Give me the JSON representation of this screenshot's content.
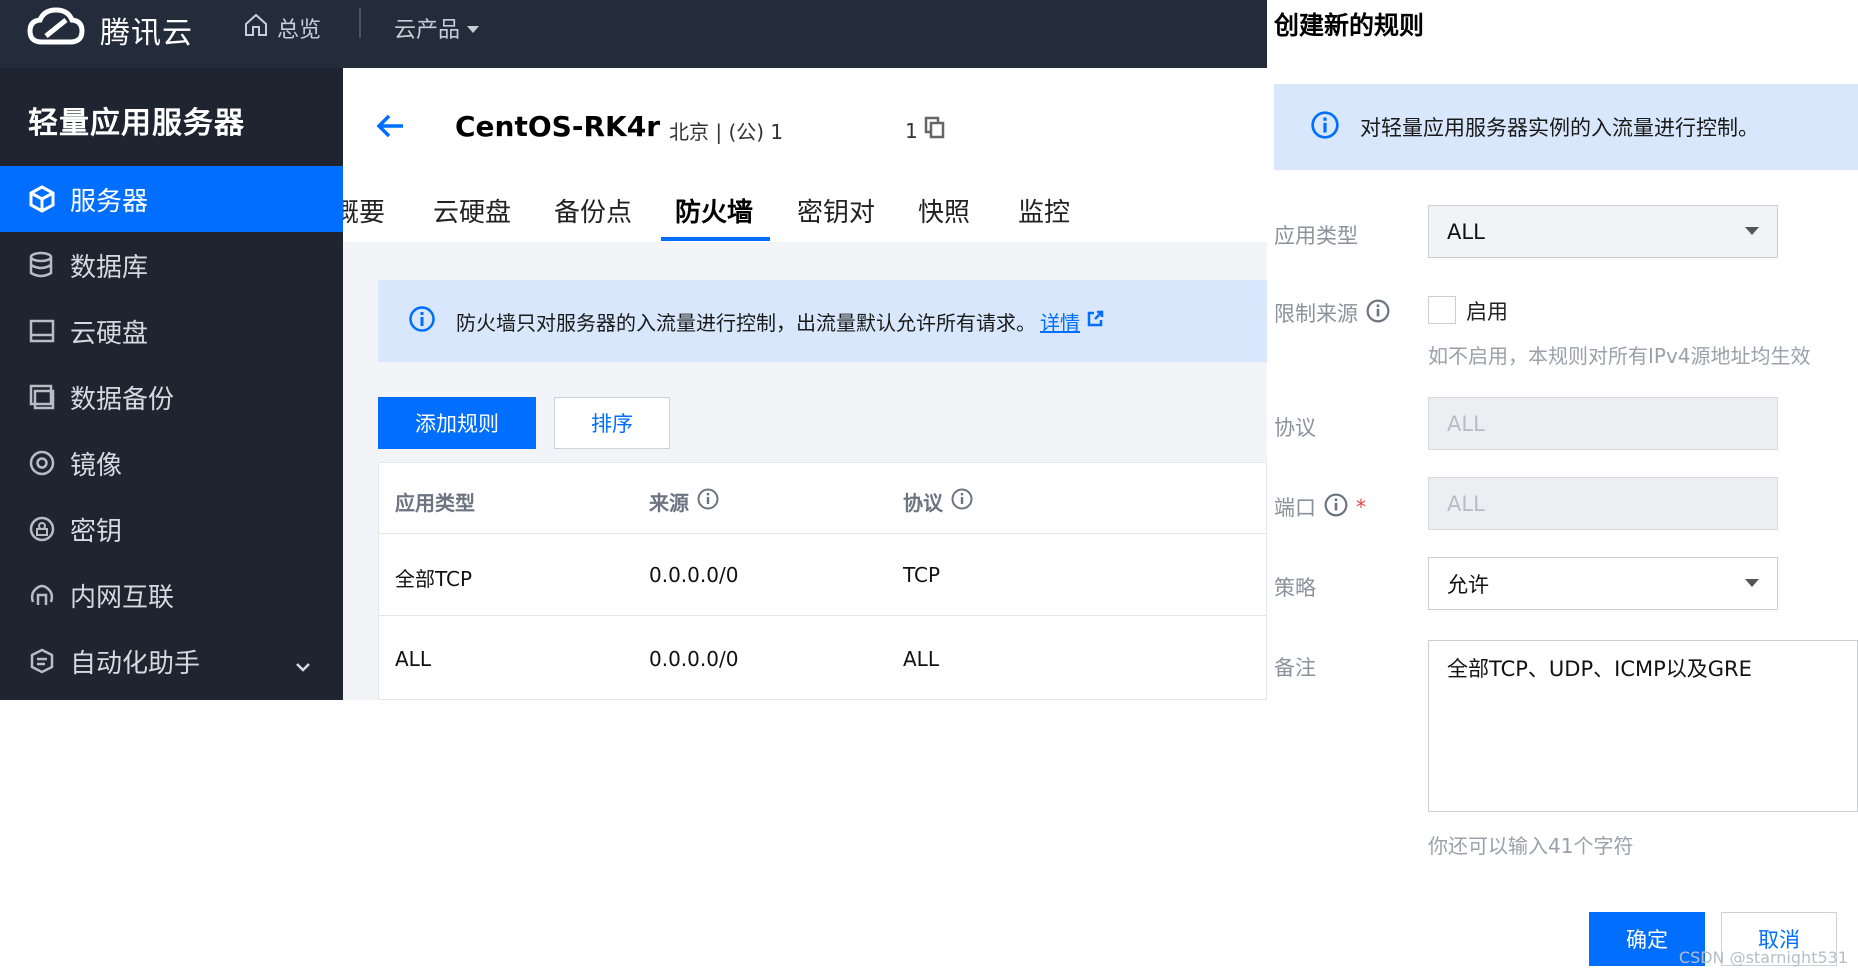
{
  "topbar": {
    "brand": "腾讯云",
    "overview": "总览",
    "products": "云产品"
  },
  "sidebar": {
    "product_title": "轻量应用服务器",
    "items": [
      {
        "label": "服务器",
        "icon": "cube-icon",
        "active": true
      },
      {
        "label": "数据库",
        "icon": "database-icon"
      },
      {
        "label": "云硬盘",
        "icon": "disk-icon"
      },
      {
        "label": "数据备份",
        "icon": "backup-icon"
      },
      {
        "label": "镜像",
        "icon": "image-icon"
      },
      {
        "label": "密钥",
        "icon": "key-icon"
      },
      {
        "label": "内网互联",
        "icon": "network-icon"
      },
      {
        "label": "自动化助手",
        "icon": "automation-icon"
      }
    ]
  },
  "instance": {
    "name": "CentOS-RK4r",
    "region": "北京 | (公) 1",
    "ip_tail": "1"
  },
  "tabs": [
    "概要",
    "云硬盘",
    "备份点",
    "防火墙",
    "密钥对",
    "快照",
    "监控"
  ],
  "firewall": {
    "notice": "防火墙只对服务器的入流量进行控制，出流量默认允许所有请求。",
    "detail_link": "详情",
    "add_rule": "添加规则",
    "sort": "排序",
    "columns": [
      "应用类型",
      "来源",
      "协议"
    ],
    "rows": [
      [
        "全部TCP",
        "0.0.0.0/0",
        "TCP"
      ],
      [
        "ALL",
        "0.0.0.0/0",
        "ALL"
      ]
    ]
  },
  "drawer": {
    "title": "创建新的规则",
    "notice": "对轻量应用服务器实例的入流量进行控制。",
    "app_type_label": "应用类型",
    "app_type_value": "ALL",
    "source_label": "限制来源",
    "enable_label": "启用",
    "source_hint": "如不启用，本规则对所有IPv4源地址均生效",
    "protocol_label": "协议",
    "protocol_value": "ALL",
    "port_label": "端口",
    "port_value": "ALL",
    "required_mark": "*",
    "policy_label": "策略",
    "policy_value": "允许",
    "remark_label": "备注",
    "remark_value": "全部TCP、UDP、ICMP以及GRE",
    "remark_hint": "你还可以输入41个字符",
    "confirm": "确定",
    "cancel": "取消"
  },
  "watermark": "CSDN @starnight531",
  "colors": {
    "accent": "#006eff",
    "topbar": "#232c3b",
    "sidebar": "#1f2431",
    "notice_bg": "#d8e7fb"
  }
}
